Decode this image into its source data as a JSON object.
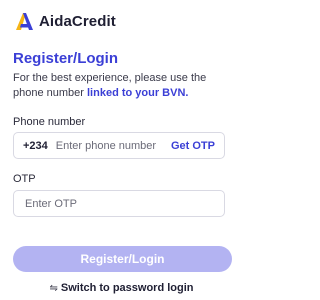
{
  "app": {
    "name": "AidaCredit",
    "logo_icon": "aidacredit-logo-icon",
    "brand_colors": [
      "#f5b517",
      "#3b3fd6",
      "#1f1f33"
    ]
  },
  "page": {
    "title": "Register/Login",
    "description_prefix": "For the best experience, please use the phone number ",
    "description_link": "linked to your BVN."
  },
  "phone": {
    "label": "Phone number",
    "prefix": "+234",
    "placeholder": "Enter phone number",
    "value": "",
    "get_otp_label": "Get OTP"
  },
  "otp": {
    "label": "OTP",
    "placeholder": "Enter OTP",
    "value": ""
  },
  "actions": {
    "submit_label": "Register/Login",
    "submit_color": "#b3b3f2",
    "switch_icon": "switch-arrows-icon",
    "switch_glyph": "⇋",
    "switch_label": "Switch to password login"
  },
  "colors": {
    "accent": "#3b3fd6",
    "text": "#1f1f33"
  }
}
